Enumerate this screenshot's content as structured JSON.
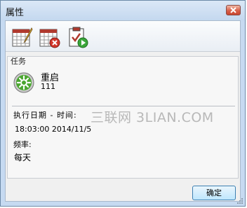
{
  "window": {
    "title": "属性"
  },
  "toolbar": {
    "buttons": [
      {
        "name": "edit-task",
        "icon": "calendar-edit-icon"
      },
      {
        "name": "delete-task",
        "icon": "calendar-delete-icon"
      },
      {
        "name": "run-task",
        "icon": "clipboard-run-icon"
      }
    ]
  },
  "task": {
    "group_label": "任务",
    "name": "重启",
    "id": "111",
    "icon": "restart-icon",
    "exec_label": "执行日期 - 时间:",
    "exec_value": "18:03:00 2014/11/5",
    "freq_label": "频率:",
    "freq_value": "每天"
  },
  "watermark": "三联网 3LIAN.COM",
  "footer": {
    "ok_label": "确定"
  }
}
